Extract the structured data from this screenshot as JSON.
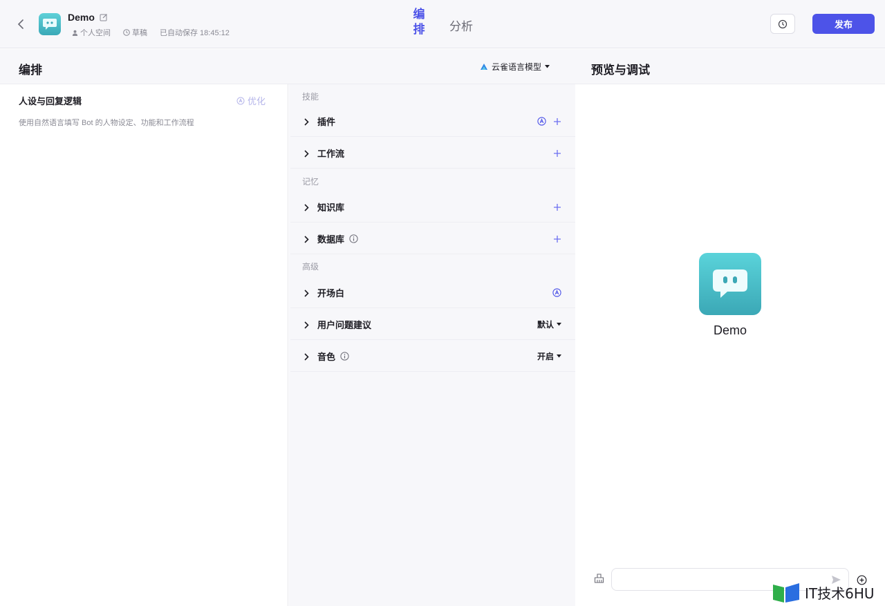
{
  "header": {
    "bot_name": "Demo",
    "space": "个人空间",
    "status": "草稿",
    "autosave": "已自动保存 18:45:12",
    "tab_active": "编排",
    "tab_other": "分析",
    "publish_label": "发布"
  },
  "subbar": {
    "title": "编排",
    "model": "云雀语言模型",
    "preview_title": "预览与调试"
  },
  "prompt": {
    "title": "人设与回复逻辑",
    "optimize_label": "优化",
    "placeholder": "使用自然语言填写 Bot 的人物设定、功能和工作流程"
  },
  "sections": {
    "skills": "技能",
    "memory": "记忆",
    "advanced": "高级"
  },
  "rows": {
    "plugins": "插件",
    "workflow": "工作流",
    "knowledge": "知识库",
    "database": "数据库",
    "opening": "开场白",
    "suggestions": "用户问题建议",
    "suggestions_value": "默认",
    "voice": "音色",
    "voice_value": "开启"
  },
  "preview": {
    "bot_name": "Demo"
  },
  "watermark": {
    "text": "IT技术6HU"
  },
  "colors": {
    "accent": "#4d53e8",
    "avatar": "#4bbec8"
  }
}
